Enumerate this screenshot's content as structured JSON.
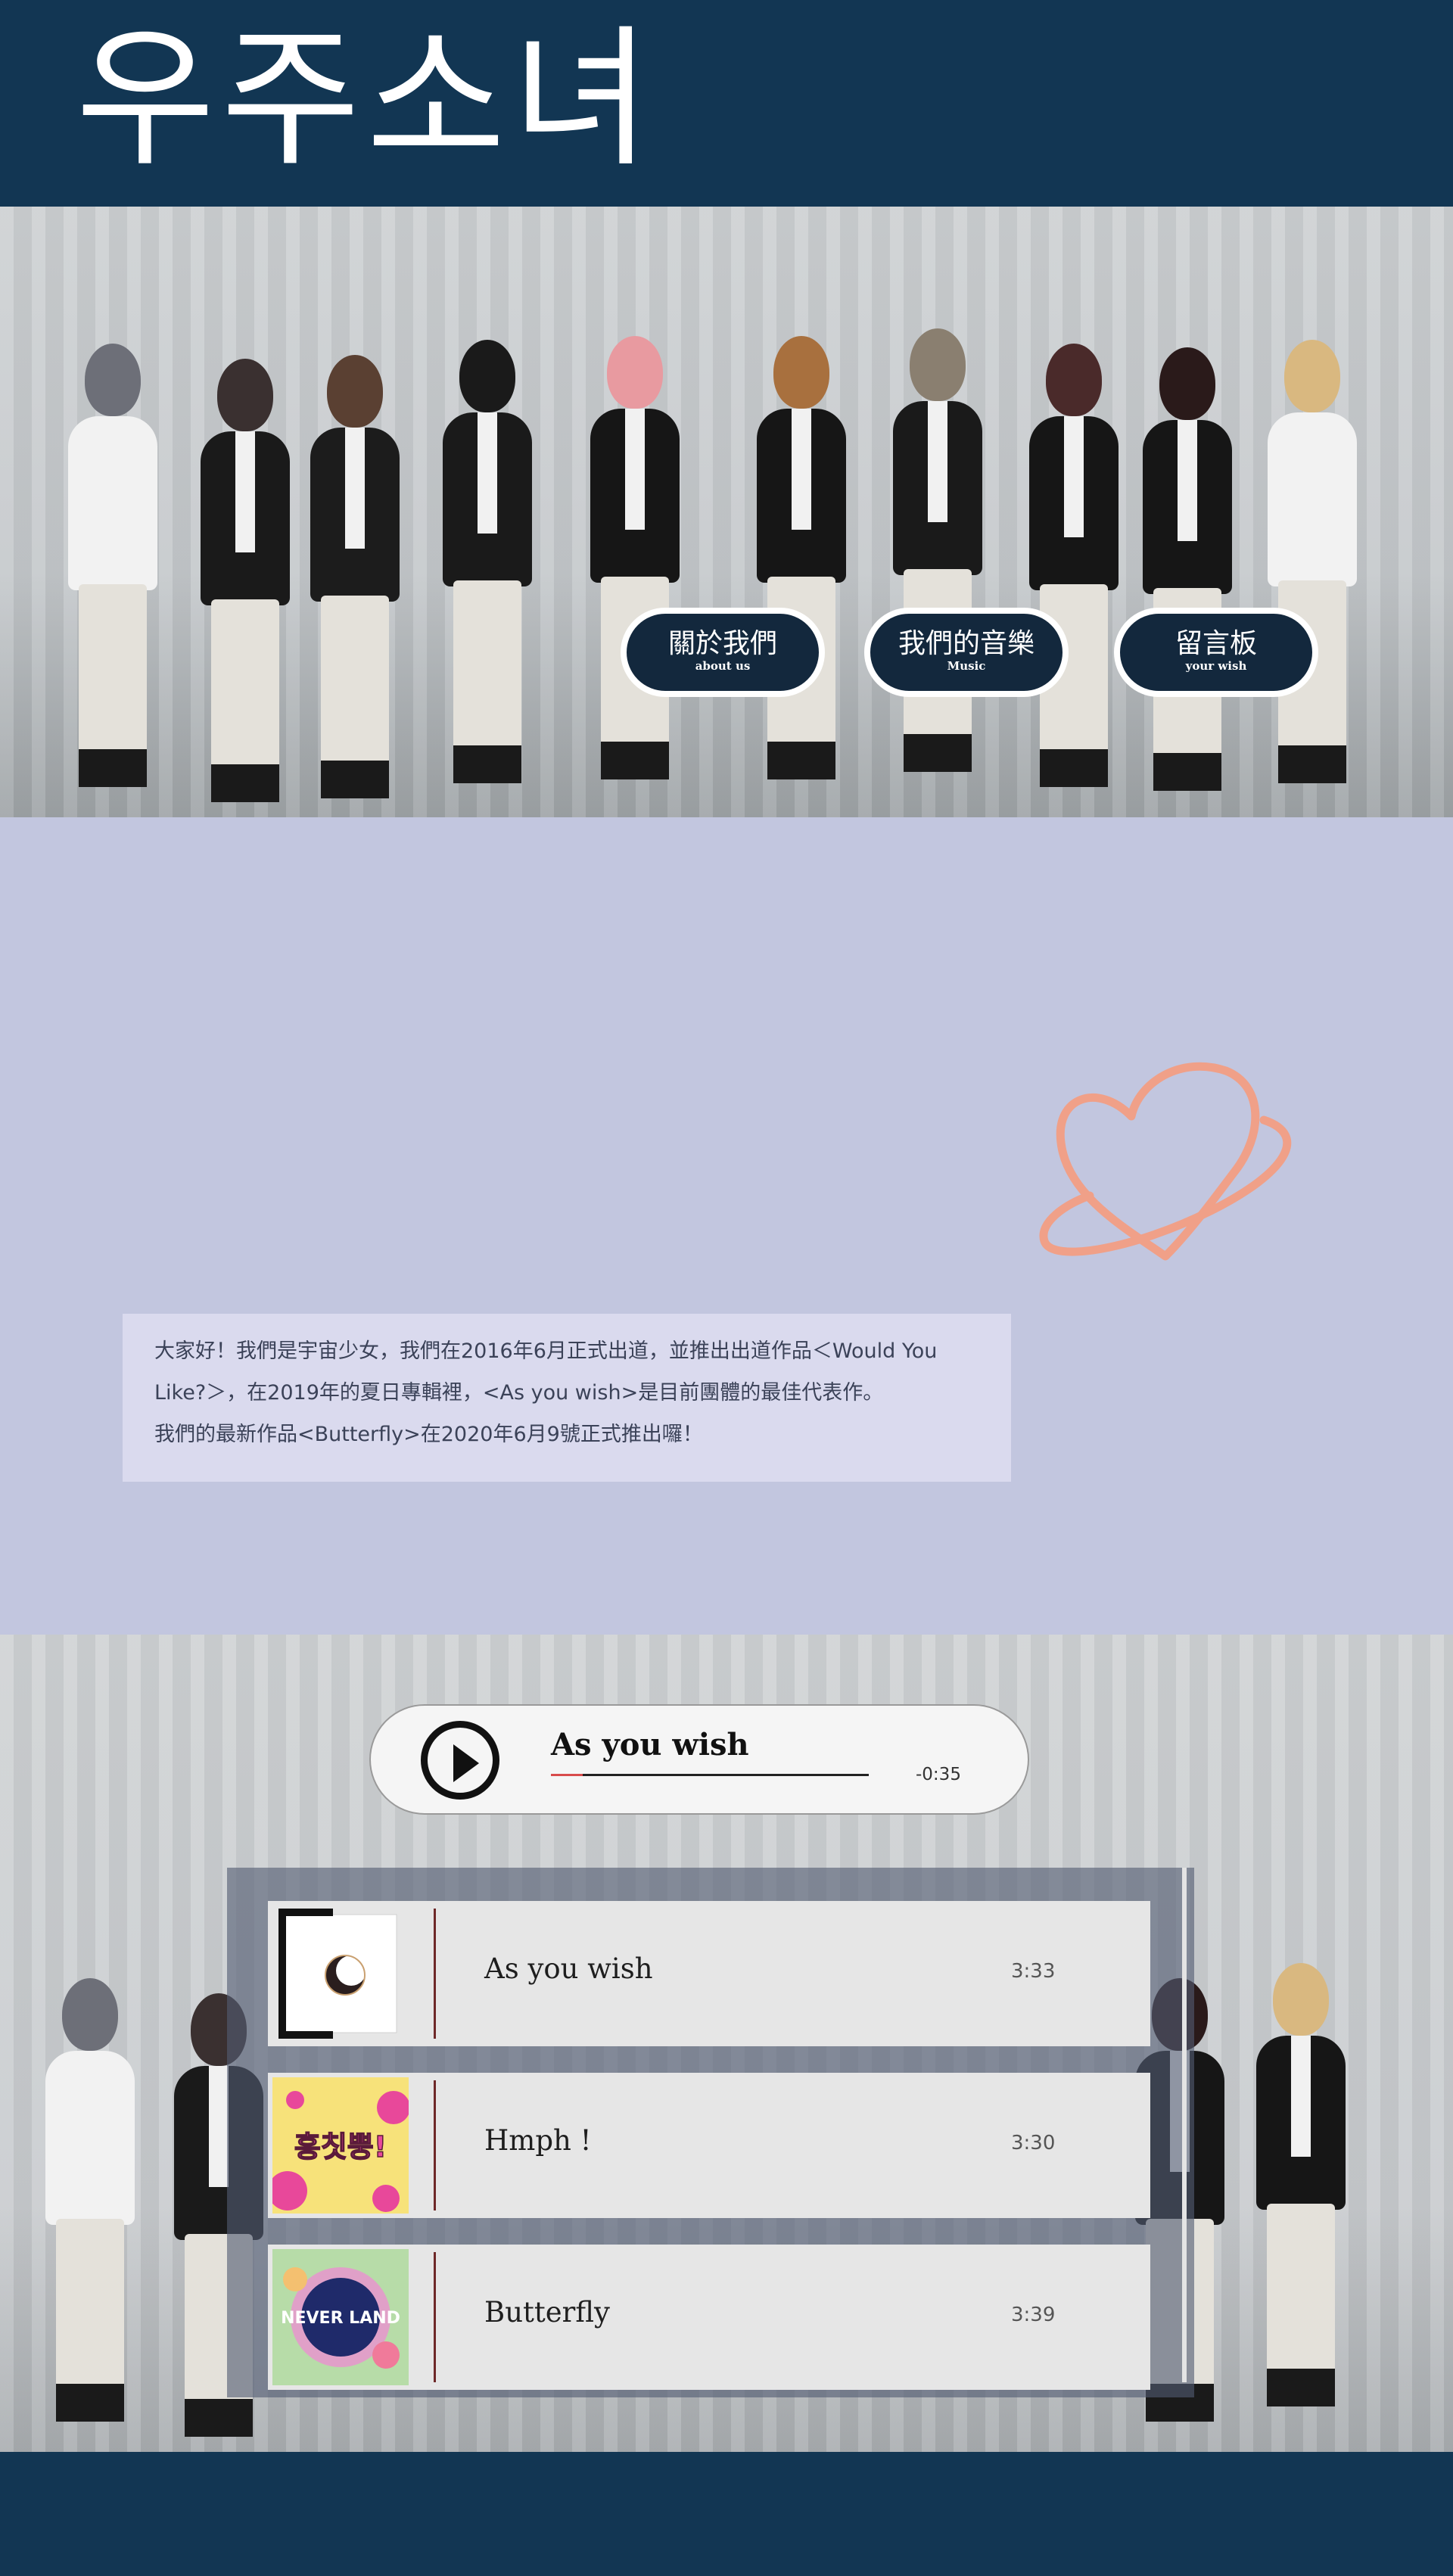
{
  "header": {
    "brand": "우주소녀"
  },
  "nav": [
    {
      "label": "關於我們",
      "sub": "about us"
    },
    {
      "label": "我們的音樂",
      "sub": "Music"
    },
    {
      "label": "留言板",
      "sub": "your wish"
    }
  ],
  "about": {
    "lines": [
      "大家好！我們是宇宙少女，我們在2016年6月正式出道，並推出出道作品＜Would You",
      "Like?＞，在2019年的夏日專輯裡，<As you wish>是目前團體的最佳代表作。",
      "我們的最新作品<Butterfly>在2020年6月9號正式推出囉！"
    ]
  },
  "player": {
    "now_playing": "As you wish",
    "remaining": "-0:35",
    "progress": 0.1
  },
  "tracks": [
    {
      "title": "As you wish",
      "duration": "3:33"
    },
    {
      "title": "Hmph !",
      "duration": "3:30"
    },
    {
      "title": "Butterfly",
      "duration": "3:39"
    }
  ],
  "covers": {
    "hmph_text": "흥칫뿡!",
    "butterfly_text": "NEVER LAND"
  },
  "colors": {
    "navy": "#123653",
    "lavender": "#c2c6df",
    "heart": "#f0a088",
    "accent_red": "#d84b4b"
  }
}
